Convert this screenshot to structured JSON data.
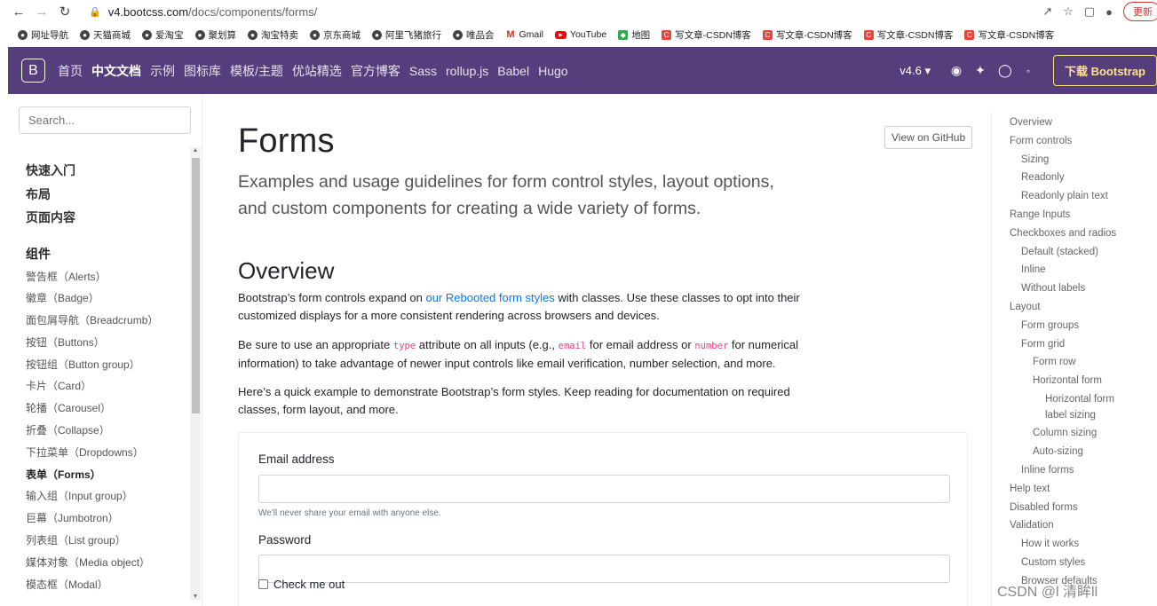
{
  "browser": {
    "url_host": "v4.bootcss.com",
    "url_path": "/docs/components/forms/",
    "update_label": "更新"
  },
  "bookmarks": [
    {
      "label": "网址导航",
      "icon": "globe-icon"
    },
    {
      "label": "天猫商城",
      "icon": "globe-icon"
    },
    {
      "label": "爱淘宝",
      "icon": "globe-icon"
    },
    {
      "label": "聚划算",
      "icon": "globe-icon"
    },
    {
      "label": "淘宝特卖",
      "icon": "globe-icon"
    },
    {
      "label": "京东商城",
      "icon": "globe-icon"
    },
    {
      "label": "阿里飞猪旅行",
      "icon": "globe-icon"
    },
    {
      "label": "唯品会",
      "icon": "globe-icon"
    },
    {
      "label": "Gmail",
      "icon": "gmail-icon"
    },
    {
      "label": "YouTube",
      "icon": "youtube-icon"
    },
    {
      "label": "地图",
      "icon": "map-icon"
    },
    {
      "label": "写文章-CSDN博客",
      "icon": "csdn-icon"
    },
    {
      "label": "写文章-CSDN博客",
      "icon": "csdn-icon"
    },
    {
      "label": "写文章-CSDN博客",
      "icon": "csdn-icon"
    },
    {
      "label": "写文章-CSDN博客",
      "icon": "csdn-icon"
    }
  ],
  "navbar": {
    "brand": "B",
    "links": [
      "首页",
      "中文文档",
      "示例",
      "图标库",
      "模板/主题",
      "优站精选",
      "官方博客",
      "Sass",
      "rollup.js",
      "Babel",
      "Hugo"
    ],
    "active_index": 1,
    "version": "v4.6",
    "download_label": "下载 Bootstrap"
  },
  "sidebar": {
    "search_placeholder": "Search...",
    "top_links": [
      "快速入门",
      "布局",
      "页面内容"
    ],
    "group_title": "组件",
    "items": [
      "警告框（Alerts）",
      "徽章（Badge）",
      "面包屑导航（Breadcrumb）",
      "按钮（Buttons）",
      "按钮组（Button group）",
      "卡片（Card）",
      "轮播（Carousel）",
      "折叠（Collapse）",
      "下拉菜单（Dropdowns）",
      "表单（Forms）",
      "输入组（Input group）",
      "巨幕（Jumbotron）",
      "列表组（List group）",
      "媒体对象（Media object）",
      "模态框（Modal）"
    ],
    "current_index": 9
  },
  "main": {
    "title": "Forms",
    "github_label": "View on GitHub",
    "lead": "Examples and usage guidelines for form control styles, layout options, and custom components for creating a wide variety of forms.",
    "overview_heading": "Overview",
    "p1_before": "Bootstrap’s form controls expand on ",
    "p1_link": "our Rebooted form styles",
    "p1_after": " with classes. Use these classes to opt into their customized displays for a more consistent rendering across browsers and devices.",
    "p2_a": "Be sure to use an appropriate ",
    "p2_code1": "type",
    "p2_b": " attribute on all inputs (e.g., ",
    "p2_code2": "email",
    "p2_c": " for email address or ",
    "p2_code3": "number",
    "p2_d": " for numerical information) to take advantage of newer input controls like email verification, number selection, and more.",
    "p3": "Here’s a quick example to demonstrate Bootstrap’s form styles. Keep reading for documentation on required classes, form layout, and more.",
    "form": {
      "email_label": "Email address",
      "email_help": "We'll never share your email with anyone else.",
      "password_label": "Password",
      "check_label": "Check me out"
    }
  },
  "toc": [
    {
      "label": "Overview",
      "level": 0
    },
    {
      "label": "Form controls",
      "level": 0
    },
    {
      "label": "Sizing",
      "level": 1
    },
    {
      "label": "Readonly",
      "level": 1
    },
    {
      "label": "Readonly plain text",
      "level": 1
    },
    {
      "label": "Range Inputs",
      "level": 0
    },
    {
      "label": "Checkboxes and radios",
      "level": 0
    },
    {
      "label": "Default (stacked)",
      "level": 1
    },
    {
      "label": "Inline",
      "level": 1
    },
    {
      "label": "Without labels",
      "level": 1
    },
    {
      "label": "Layout",
      "level": 0
    },
    {
      "label": "Form groups",
      "level": 1
    },
    {
      "label": "Form grid",
      "level": 1
    },
    {
      "label": "Form row",
      "level": 2
    },
    {
      "label": "Horizontal form",
      "level": 2
    },
    {
      "label": "Horizontal form",
      "level": 3
    },
    {
      "label": "label sizing",
      "level": 3
    },
    {
      "label": "Column sizing",
      "level": 2
    },
    {
      "label": "Auto-sizing",
      "level": 2
    },
    {
      "label": "Inline forms",
      "level": 1
    },
    {
      "label": "Help text",
      "level": 0
    },
    {
      "label": "Disabled forms",
      "level": 0
    },
    {
      "label": "Validation",
      "level": 0
    },
    {
      "label": "How it works",
      "level": 1
    },
    {
      "label": "Custom styles",
      "level": 1
    },
    {
      "label": "Browser defaults",
      "level": 1
    }
  ],
  "watermark": "CSDN @l 清眸ll"
}
